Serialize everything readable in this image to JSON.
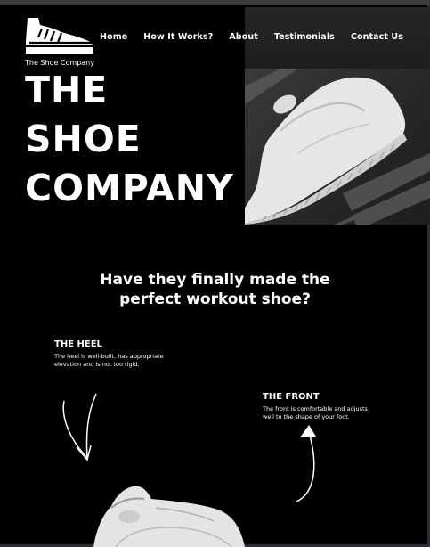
{
  "brand": {
    "logo_text": "The Shoe Company",
    "logo_icon": "sneaker-icon"
  },
  "nav": [
    {
      "label": "Home"
    },
    {
      "label": "How It Works?"
    },
    {
      "label": "About"
    },
    {
      "label": "Testimonials"
    },
    {
      "label": "Contact Us"
    }
  ],
  "hero": {
    "title_lines": [
      "THE",
      "SHOE",
      "COMPANY"
    ]
  },
  "question": {
    "line1": "Have they finally made the",
    "line2": "perfect workout shoe?"
  },
  "features": {
    "heel": {
      "title": "THE HEEL",
      "desc_line1": "The heel is well-built, has appropriate",
      "desc_line2": "elevation and is not too rigid."
    },
    "front": {
      "title": "THE FRONT",
      "desc_line1": "The front is comfortable and adjusts",
      "desc_line2": "well to the shape of your foot."
    }
  },
  "colors": {
    "background": "#000000",
    "text": "#ffffff",
    "nav_panel": "#222222"
  },
  "icons": [
    "sneaker-icon",
    "hand-drawn-arrow-down-icon",
    "hand-drawn-arrow-up-icon"
  ]
}
